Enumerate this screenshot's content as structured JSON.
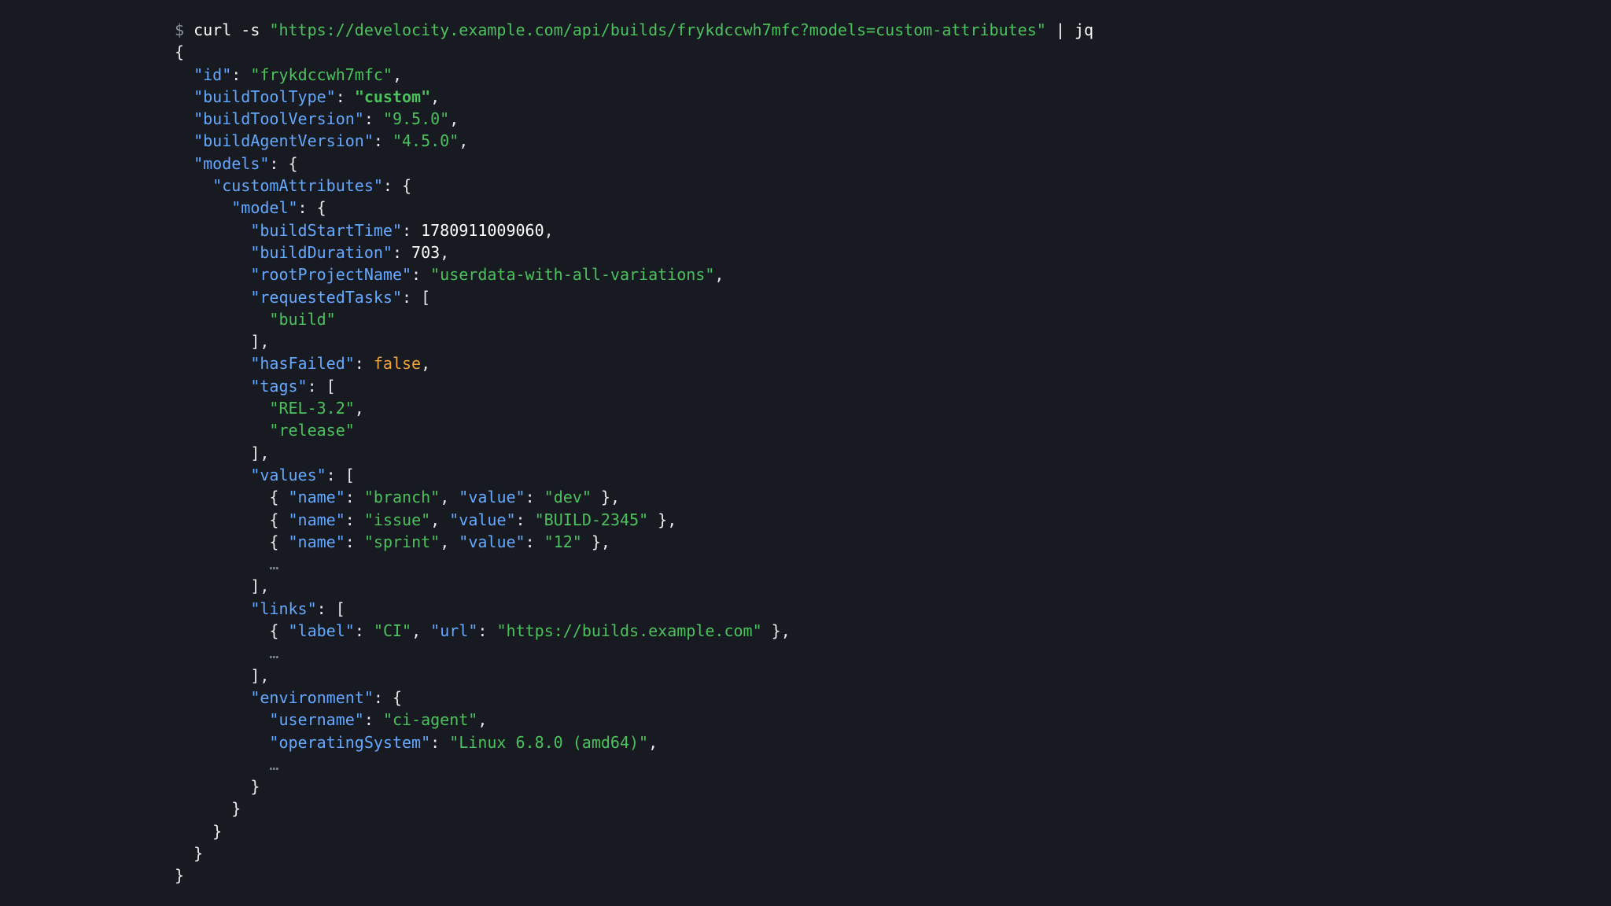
{
  "prompt": "$",
  "command": {
    "program": "curl -s",
    "url": "\"https://develocity.example.com/api/builds/frykdccwh7mfc?models=custom-attributes\"",
    "pipe": "| jq"
  },
  "json": {
    "id_key": "\"id\"",
    "id_val": "\"frykdccwh7mfc\"",
    "buildToolType_key": "\"buildToolType\"",
    "buildToolType_val": "\"custom\"",
    "buildToolVersion_key": "\"buildToolVersion\"",
    "buildToolVersion_val": "\"9.5.0\"",
    "buildAgentVersion_key": "\"buildAgentVersion\"",
    "buildAgentVersion_val": "\"4.5.0\"",
    "models_key": "\"models\"",
    "customAttributes_key": "\"customAttributes\"",
    "model_key": "\"model\"",
    "buildStartTime_key": "\"buildStartTime\"",
    "buildStartTime_val": "1780911009060",
    "buildDuration_key": "\"buildDuration\"",
    "buildDuration_val": "703",
    "rootProjectName_key": "\"rootProjectName\"",
    "rootProjectName_val": "\"userdata-with-all-variations\"",
    "requestedTasks_key": "\"requestedTasks\"",
    "requestedTasks_0": "\"build\"",
    "hasFailed_key": "\"hasFailed\"",
    "hasFailed_val": "false",
    "tags_key": "\"tags\"",
    "tags_0": "\"REL-3.2\"",
    "tags_1": "\"release\"",
    "values_key": "\"values\"",
    "name_key": "\"name\"",
    "value_key": "\"value\"",
    "values": [
      {
        "name": "\"branch\"",
        "value": "\"dev\""
      },
      {
        "name": "\"issue\"",
        "value": "\"BUILD-2345\""
      },
      {
        "name": "\"sprint\"",
        "value": "\"12\""
      }
    ],
    "ellipsis": "…",
    "links_key": "\"links\"",
    "label_key": "\"label\"",
    "url_key": "\"url\"",
    "links_0_label": "\"CI\"",
    "links_0_url": "\"https://builds.example.com\"",
    "environment_key": "\"environment\"",
    "username_key": "\"username\"",
    "username_val": "\"ci-agent\"",
    "operatingSystem_key": "\"operatingSystem\"",
    "operatingSystem_val": "\"Linux 6.8.0 (amd64)\""
  }
}
